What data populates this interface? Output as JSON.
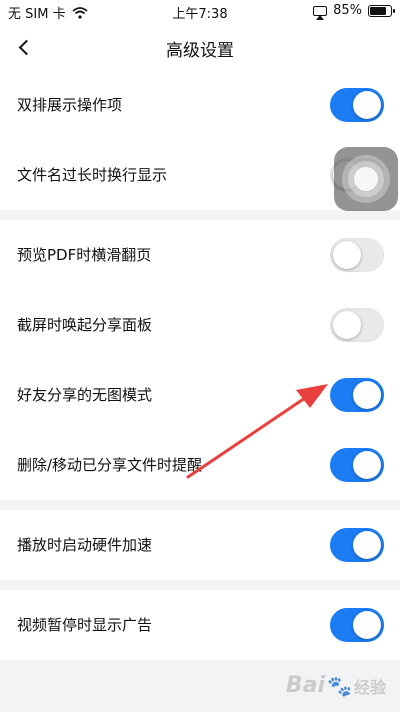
{
  "status_bar": {
    "carrier": "无 SIM 卡",
    "time": "上午7:38",
    "battery": "85%",
    "battery_level": 0.85,
    "icons": [
      "wifi-icon",
      "airplay-icon",
      "battery-icon"
    ]
  },
  "nav": {
    "title": "高级设置",
    "back_icon": "chevron-left-icon"
  },
  "colors": {
    "accent": "#1c7cf4",
    "toggle_off": "#e9e9ea",
    "background": "#f2f3f5",
    "arrow": "#e8403c"
  },
  "sections": [
    {
      "rows": [
        {
          "label": "双排展示操作项",
          "on": true
        },
        {
          "label": "文件名过长时换行显示",
          "on": false
        }
      ]
    },
    {
      "rows": [
        {
          "label": "预览PDF时横滑翻页",
          "on": false
        },
        {
          "label": "截屏时唤起分享面板",
          "on": false
        },
        {
          "label": "好友分享的无图模式",
          "on": true
        },
        {
          "label": "删除/移动已分享文件时提醒",
          "on": true
        }
      ]
    },
    {
      "rows": [
        {
          "label": "播放时启动硬件加速",
          "on": true
        }
      ]
    },
    {
      "rows": [
        {
          "label": "视频暂停时显示广告",
          "on": true
        }
      ]
    }
  ],
  "watermark": {
    "logo_text": "Bai",
    "brand_text": "经验",
    "icon": "paw-icon"
  }
}
